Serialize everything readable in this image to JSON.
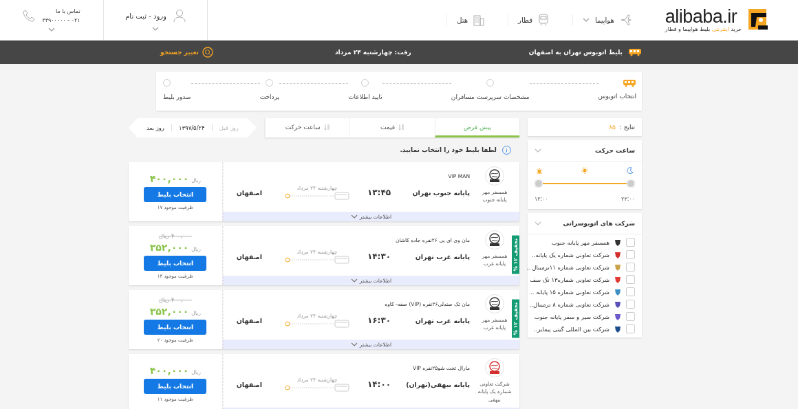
{
  "header": {
    "logo": "alibaba.ir",
    "tagline": [
      "خرید",
      "اینترنتی",
      "بلیط هواپیما و قطار"
    ],
    "nav": [
      {
        "kind": "plane",
        "label": "هواپیما",
        "dropdown": true
      },
      {
        "kind": "train",
        "label": "قطار",
        "dropdown": false
      },
      {
        "kind": "hotel",
        "label": "هتل",
        "dropdown": false
      }
    ],
    "login": "ورود - ثبت نام",
    "contact": {
      "label": "تماس با ما",
      "phone": "۰۲۱ - ۴۳۹۰۰۰۰۰"
    }
  },
  "search_bar": {
    "route": "بلیط اتوبوس  تهران به اصفهان",
    "date": "رفت: چهارشنبه ۲۴ مرداد",
    "change": "تغییر جستجو"
  },
  "steps": [
    {
      "label": "انتخاب اتوبوس",
      "done": true
    },
    {
      "label": "مشخصات سرپرست مسافران",
      "done": false
    },
    {
      "label": "تایید اطلاعات",
      "done": false
    },
    {
      "label": "پرداخت",
      "done": false
    },
    {
      "label": "صدور بلیط",
      "done": false
    }
  ],
  "sort_tabs": [
    {
      "label": "پیش فرض",
      "selected": true
    },
    {
      "label": "قیمت",
      "selected": false
    },
    {
      "label": "ساعت حرکت",
      "selected": false
    }
  ],
  "date_nav": {
    "prev": "روز قبل",
    "prev_disabled": true,
    "date": "۱۳۹۷/۵/۲۴",
    "next": "روز بعد"
  },
  "notice": "لطفا بلیط خود را انتخاب نمایید.",
  "tickets": [
    {
      "company": "همسفر مهر پایانه جنوب",
      "color": "#333333",
      "bus": "VIP MAN",
      "origin": "پایانه جنوب تهران",
      "time": "۱۳:۴۵",
      "date": "چهارشنبه ۲۴ مرداد",
      "destination": "اصفهان",
      "more": "اطلاعات بیشتر",
      "price": "۴۰۰,۰۰۰",
      "currency": "ریال",
      "button": "انتخاب بلیط",
      "capacity": "ظرفیت موجود ۱۷"
    },
    {
      "company": "همسفر مهر پایانه غرب",
      "color": "#333333",
      "bus": "مان وی ای پی ۲۶نفره جاده کاشان",
      "origin": "پایانه غرب تهران",
      "time": "۱۴:۳۰",
      "date": "چهارشنبه ۲۴ مرداد",
      "destination": "اصفهان",
      "more": "اطلاعات بیشتر",
      "discount": "تخفیف ۱۲ %",
      "old_price": "۴۰۰,۰۰۰ ریال",
      "price": "۳۵۲,۰۰۰",
      "currency": "ریال",
      "button": "انتخاب بلیط",
      "capacity": "ظرفیت موجود ۱۴"
    },
    {
      "company": "همسفر مهر پایانه غرب",
      "color": "#333333",
      "bus": "مان تک صندلی۲۶نفره (VIP) صفه- کاوه",
      "origin": "پایانه غرب تهران",
      "time": "۱۶:۳۰",
      "date": "چهارشنبه ۲۴ مرداد",
      "destination": "اصفهان",
      "more": "اطلاعات بیشتر",
      "discount": "تخفیف ۱۲ %",
      "old_price": "۴۰۰,۰۰۰ ریال",
      "price": "۳۵۲,۰۰۰",
      "currency": "ریال",
      "button": "انتخاب بلیط",
      "capacity": "ظرفیت موجود ۲۰"
    },
    {
      "company": "شرکت تعاونی شماره یک پایانه بیهقی",
      "color": "#d32f2f",
      "bus": "مارال تخت شو۲۵نفره VIP",
      "origin": "پایانه بیهقی(تهران)",
      "time": "۱۴:۰۰",
      "date": "چهارشنبه ۲۴ مرداد",
      "destination": "اصفهان",
      "price": "۴۰۰,۰۰۰",
      "currency": "ریال",
      "button": "انتخاب بلیط",
      "capacity": "ظرفیت موجود ۱۱"
    }
  ],
  "sidebar": {
    "results": {
      "label": "نتایج :",
      "count": "۸۵"
    },
    "time_filter": {
      "title": "ساعت حرکت",
      "level": 1,
      "right_label": "۲۴:۰۰",
      "left_label": "۱۲:۰۰"
    },
    "companies": {
      "title": "شرکت های اتوبوسرانی",
      "items": [
        {
          "name": "همسفر مهر پایانه  جنوب",
          "checked": false,
          "color": "#333333"
        },
        {
          "name": "شرکت تعاونی شماره یک پایانه..",
          "checked": false,
          "color": "#d32f2f"
        },
        {
          "name": "شرکت تعاونی شماره ۱۱ترمینال ..",
          "checked": false,
          "color": "#c9a24a"
        },
        {
          "name": "شرکت تعاونی شماره۱۳ تک سف",
          "checked": false,
          "color": "#e53935"
        },
        {
          "name": "شرکت تعاونی شماره ۱۵ پایانه ..",
          "checked": false,
          "color": "#3d8fc4"
        },
        {
          "name": "شرکت تعاونی شماره ۸ ترمینال..",
          "checked": false,
          "color": "#5b4fb8"
        },
        {
          "name": "شرکت سیر و سفر پایانه جنوب",
          "checked": false,
          "color": "#6a5acd"
        },
        {
          "name": "شرکت بین المللی گیتی پیمایر..",
          "checked": false,
          "color": "#1f4e8c"
        }
      ]
    }
  }
}
